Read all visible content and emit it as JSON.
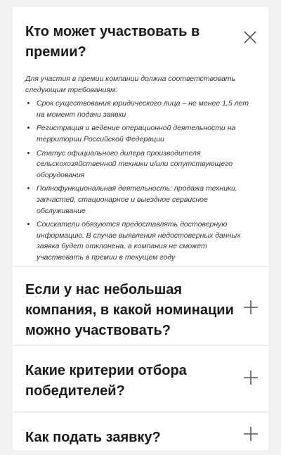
{
  "faq": [
    {
      "question": "Кто может участвовать в премии?",
      "expanded": true,
      "icon": "close-icon",
      "intro": "Для участия в премии компании должна соответствовать следующим требованиям:",
      "requirements": [
        "Срок существования юридического лица – не менее 1,5 лет на момент подачи заявки",
        "Регистрация и ведение операционной деятельности на территории Российской Федерации",
        "Статус официального дилера производителя сельскохозяйственной техники и/или сопутствующего оборудования",
        "Полнофункциональная деятельность: продажа техники, запчастей, стационарное и выездное сервисное обслуживание",
        "Соискатели обязуются предоставлять достоверную информацию. В случае выявления недостоверных данных заявка будет отклонена, а компания не сможет участвовать в премии в текущем году"
      ]
    },
    {
      "question": "Если у нас небольшая компания, в какой номинации можно участвовать?",
      "expanded": false,
      "icon": "plus-icon"
    },
    {
      "question": "Какие критерии отбора победителей?",
      "expanded": false,
      "icon": "plus-icon"
    },
    {
      "question": "Как подать заявку?",
      "expanded": false,
      "icon": "plus-icon"
    }
  ]
}
